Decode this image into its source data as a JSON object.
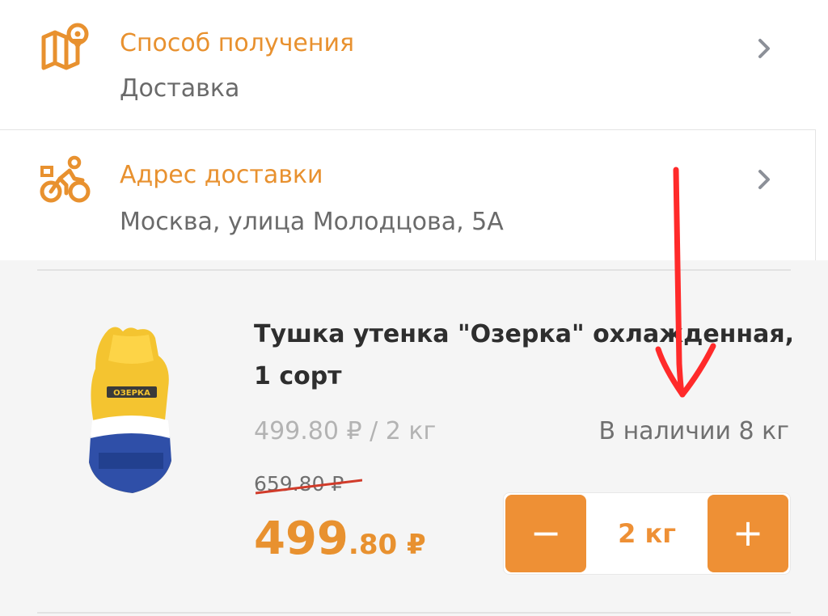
{
  "delivery_method": {
    "title": "Способ получения",
    "value": "Доставка",
    "icon": "map-pin-icon"
  },
  "delivery_address": {
    "title": "Адрес доставки",
    "value": "Москва, улица Молодцова, 5А",
    "icon": "courier-bike-icon"
  },
  "product": {
    "name": "Тушка утенка \"Озерка\" охлажденная, 1 сорт",
    "unit_price": "499.80 ₽ / 2 кг",
    "stock": "В наличии 8 кг",
    "old_price": "659.80 ₽",
    "price_int": "499",
    "price_frac": ".80 ₽",
    "quantity": "2 кг",
    "minus_label": "−",
    "plus_label": "+",
    "brand_on_package": "ОЗЕРКА"
  },
  "colors": {
    "accent": "#ee9035",
    "title_orange": "#e8912f",
    "annotation_red": "#ff2a2a"
  }
}
